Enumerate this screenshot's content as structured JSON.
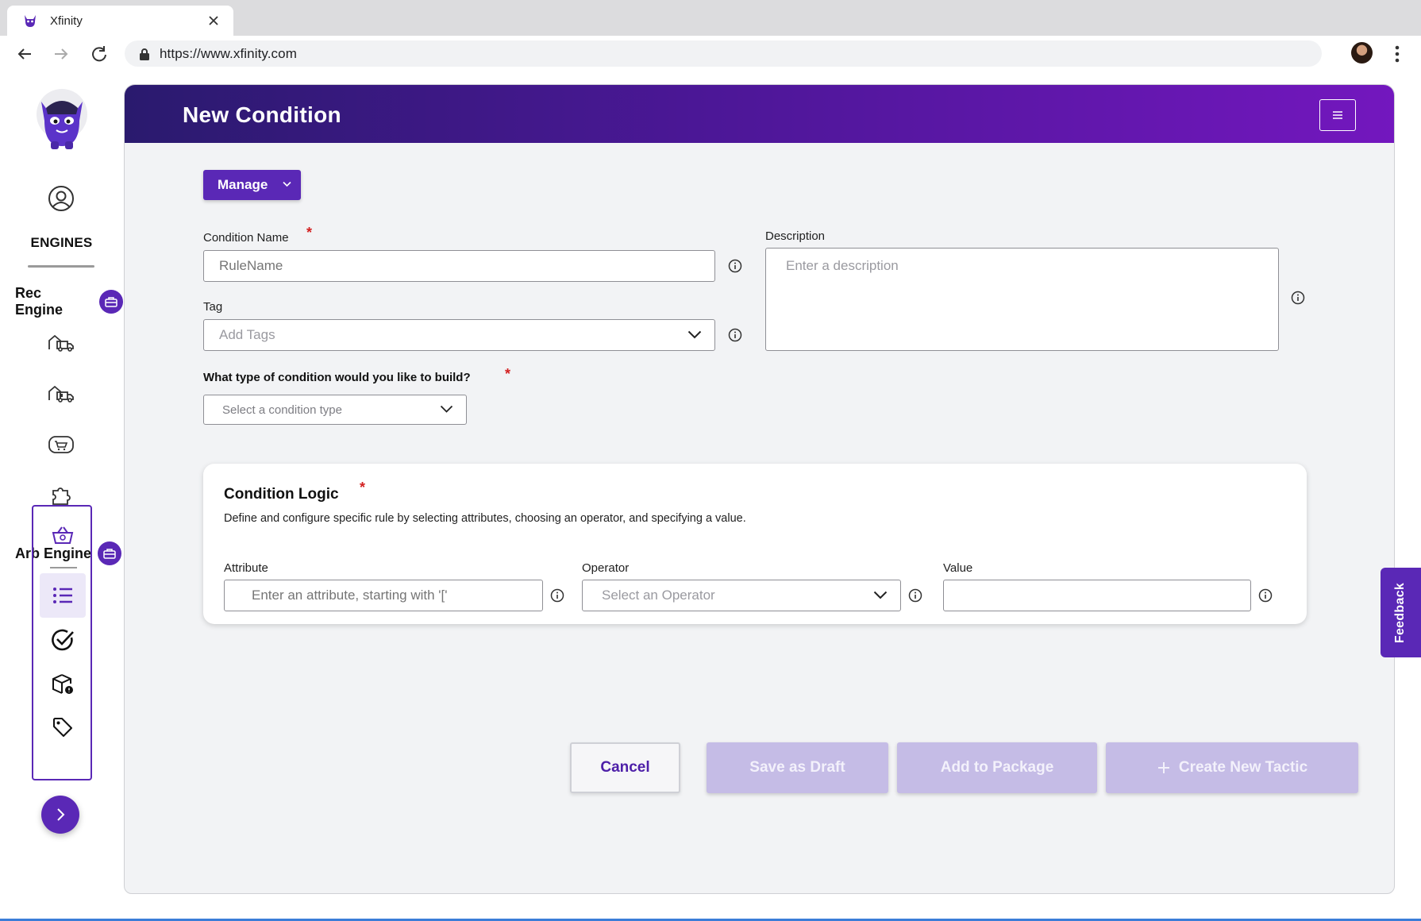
{
  "browser": {
    "tab_title": "Xfinity",
    "url": "https://www.xfinity.com"
  },
  "rail": {
    "section_title": "ENGINES",
    "rec_engine_label": "Rec Engine",
    "arb_engine_label": "Arb Engine",
    "rec_items": [
      "delivery-truck-icon",
      "delivery-truck-alt-icon",
      "shopping-cart-icon",
      "puzzle-piece-icon"
    ],
    "arb_items": [
      "basket-icon",
      "list-icon",
      "check-circle-icon",
      "package-icon",
      "tag-icon"
    ],
    "active_arb_item": "list-icon"
  },
  "page": {
    "title": "New Condition",
    "manage_label": "Manage"
  },
  "form": {
    "condition_name": {
      "label": "Condition Name",
      "placeholder": "RuleName",
      "value": "",
      "required": "*"
    },
    "tag": {
      "label": "Tag",
      "placeholder": "Add Tags"
    },
    "description": {
      "label": "Description",
      "placeholder": "Enter a description"
    },
    "condition_type": {
      "label": "What type of condition would you like to build?",
      "placeholder": "Select a condition type",
      "required": "*"
    }
  },
  "logic": {
    "title": "Condition Logic",
    "required": "*",
    "description": "Define and configure specific rule by selecting attributes, choosing an operator, and specifying a value.",
    "attribute": {
      "label": "Attribute",
      "placeholder": "Enter an attribute, starting with '['"
    },
    "operator": {
      "label": "Operator",
      "placeholder": "Select an Operator"
    },
    "value": {
      "label": "Value",
      "value": ""
    }
  },
  "actions": {
    "cancel": "Cancel",
    "save_draft": "Save as Draft",
    "add_to_package": "Add to Package",
    "create_tactic": "Create New Tactic"
  },
  "feedback_label": "Feedback",
  "colors": {
    "brand_purple": "#5a28b6",
    "header_start": "#2a1a6e",
    "header_end": "#7317be",
    "required_red": "#d32020",
    "disabled_button": "#c5bce6"
  }
}
